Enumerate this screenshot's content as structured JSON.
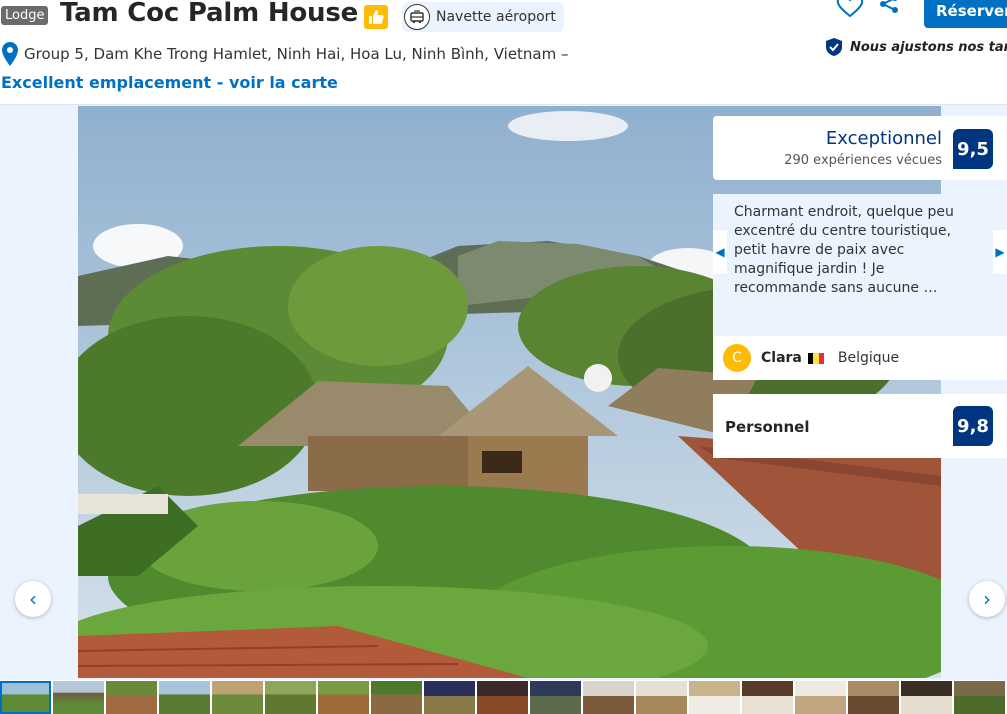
{
  "header": {
    "badge": "Lodge",
    "title": "Tam Coc Palm House",
    "shuttle_label": "Navette aéroport",
    "reserve_label": "Réserver",
    "address": "Group 5, Dam Khe Trong Hamlet, Ninh Hai, Hoa Lu, Ninh Bình, Vietnam –",
    "map_link": "Excellent emplacement - voir la carte",
    "price_note": "Nous ajustons nos tarifs"
  },
  "score": {
    "label": "Exceptionnel",
    "count": "290 expériences vécues",
    "value": "9,5"
  },
  "review": {
    "text": "Charmant endroit, quelque peu excentré du centre touristique, petit havre de paix avec magnifique jardin ! Je recommande sans aucune …",
    "avatar_letter": "C",
    "reviewer_name": "Clara",
    "reviewer_country": "Belgique"
  },
  "staff": {
    "label": "Personnel",
    "value": "9,8"
  },
  "gallery": {
    "prev_label": "‹",
    "next_label": "›"
  },
  "colors": {
    "primary": "#0071c2",
    "dark_blue": "#003580",
    "badge_yellow": "#febb02"
  },
  "icons": [
    "thumbs-up-icon",
    "shuttle-icon",
    "heart-icon",
    "share-icon",
    "location-pin-icon",
    "verified-shield-icon"
  ]
}
